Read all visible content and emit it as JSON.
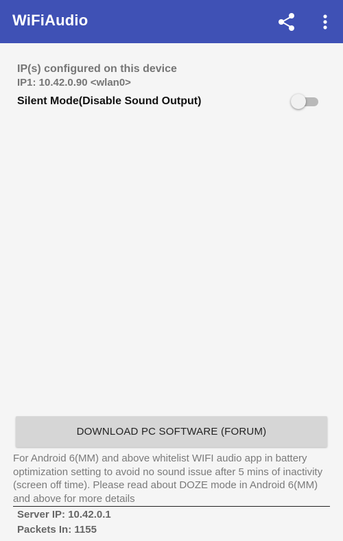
{
  "app": {
    "title": "WiFiAudio",
    "brand_color": "#3f51b5"
  },
  "toolbar": {
    "share_icon": "share-icon",
    "menu_icon": "more-vert-icon"
  },
  "network": {
    "heading": "IP(s) configured on this device",
    "ip_line": "IP1: 10.42.0.90 <wlan0>"
  },
  "silent_mode": {
    "label": "Silent Mode(Disable Sound Output)",
    "enabled": false
  },
  "download_button": {
    "label": "DOWNLOAD PC SOFTWARE (FORUM)"
  },
  "notice": {
    "text": "For Android 6(MM) and above whitelist WIFI audio app in battery optimization setting to avoid no sound issue after 5 mins of inactivity (screen off time). Please read about DOZE mode in Android 6(MM) and above for more details"
  },
  "status": {
    "server_ip": "Server IP: 10.42.0.1",
    "packets_in": "Packets In: 1155"
  }
}
